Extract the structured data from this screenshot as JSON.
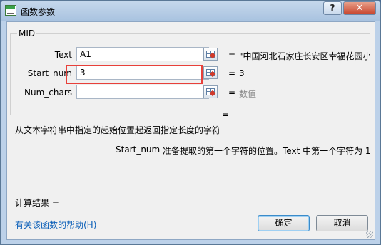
{
  "title": "函数参数",
  "titlebar_buttons": {
    "help": "?",
    "close": "✕"
  },
  "function_name": "MID",
  "args": [
    {
      "label": "Text",
      "value": "A1",
      "placeholder": "",
      "result": "\"中国河北石家庄长安区幸福花园小"
    },
    {
      "label": "Start_num",
      "value": "3",
      "placeholder": "",
      "result": "3"
    },
    {
      "label": "Num_chars",
      "value": "",
      "placeholder": "",
      "result": "数值"
    }
  ],
  "formula_equals": "=",
  "description": "从文本字符串中指定的起始位置起返回指定长度的字符",
  "arg_help": {
    "name": "Start_num",
    "text": "准备提取的第一个字符的位置。Text 中第一个字符为 1"
  },
  "calc_result_label": "计算结果 =",
  "help_link": "有关该函数的帮助(H)",
  "buttons": {
    "ok": "确定",
    "cancel": "取消"
  },
  "colors": {
    "highlight_border": "#e8403a",
    "link": "#0b5fb8",
    "placeholder_value": "#8c8c8c"
  }
}
